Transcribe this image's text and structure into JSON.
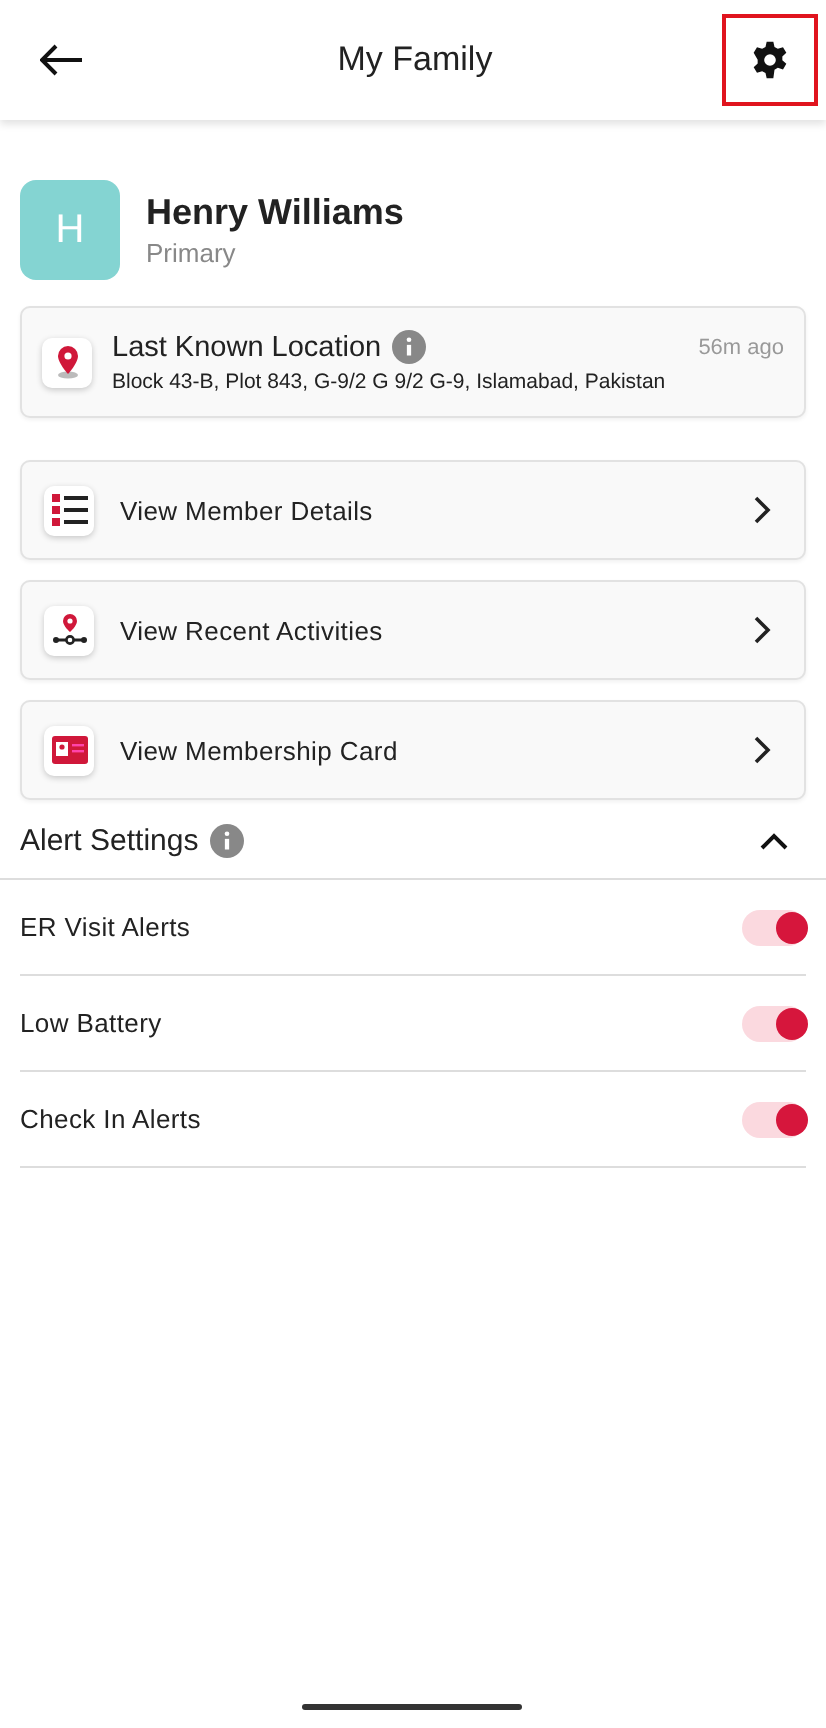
{
  "header": {
    "title": "My Family",
    "settings_highlighted": true
  },
  "member": {
    "initial": "H",
    "name": "Henry Williams",
    "role": "Primary"
  },
  "location": {
    "title": "Last Known Location",
    "time": "56m ago",
    "address": "Block 43-B, Plot 843, G-9/2 G 9/2 G-9, Islamabad, Pakistan"
  },
  "menu": [
    {
      "kind": "details",
      "label": "View Member Details"
    },
    {
      "kind": "activities",
      "label": "View Recent Activities"
    },
    {
      "kind": "card",
      "label": "View Membership Card"
    }
  ],
  "alert_settings": {
    "title": "Alert Settings",
    "expanded": true,
    "items": [
      {
        "label": "ER Visit Alerts",
        "on": true
      },
      {
        "label": "Low Battery",
        "on": true
      },
      {
        "label": "Check In Alerts",
        "on": true
      }
    ]
  }
}
